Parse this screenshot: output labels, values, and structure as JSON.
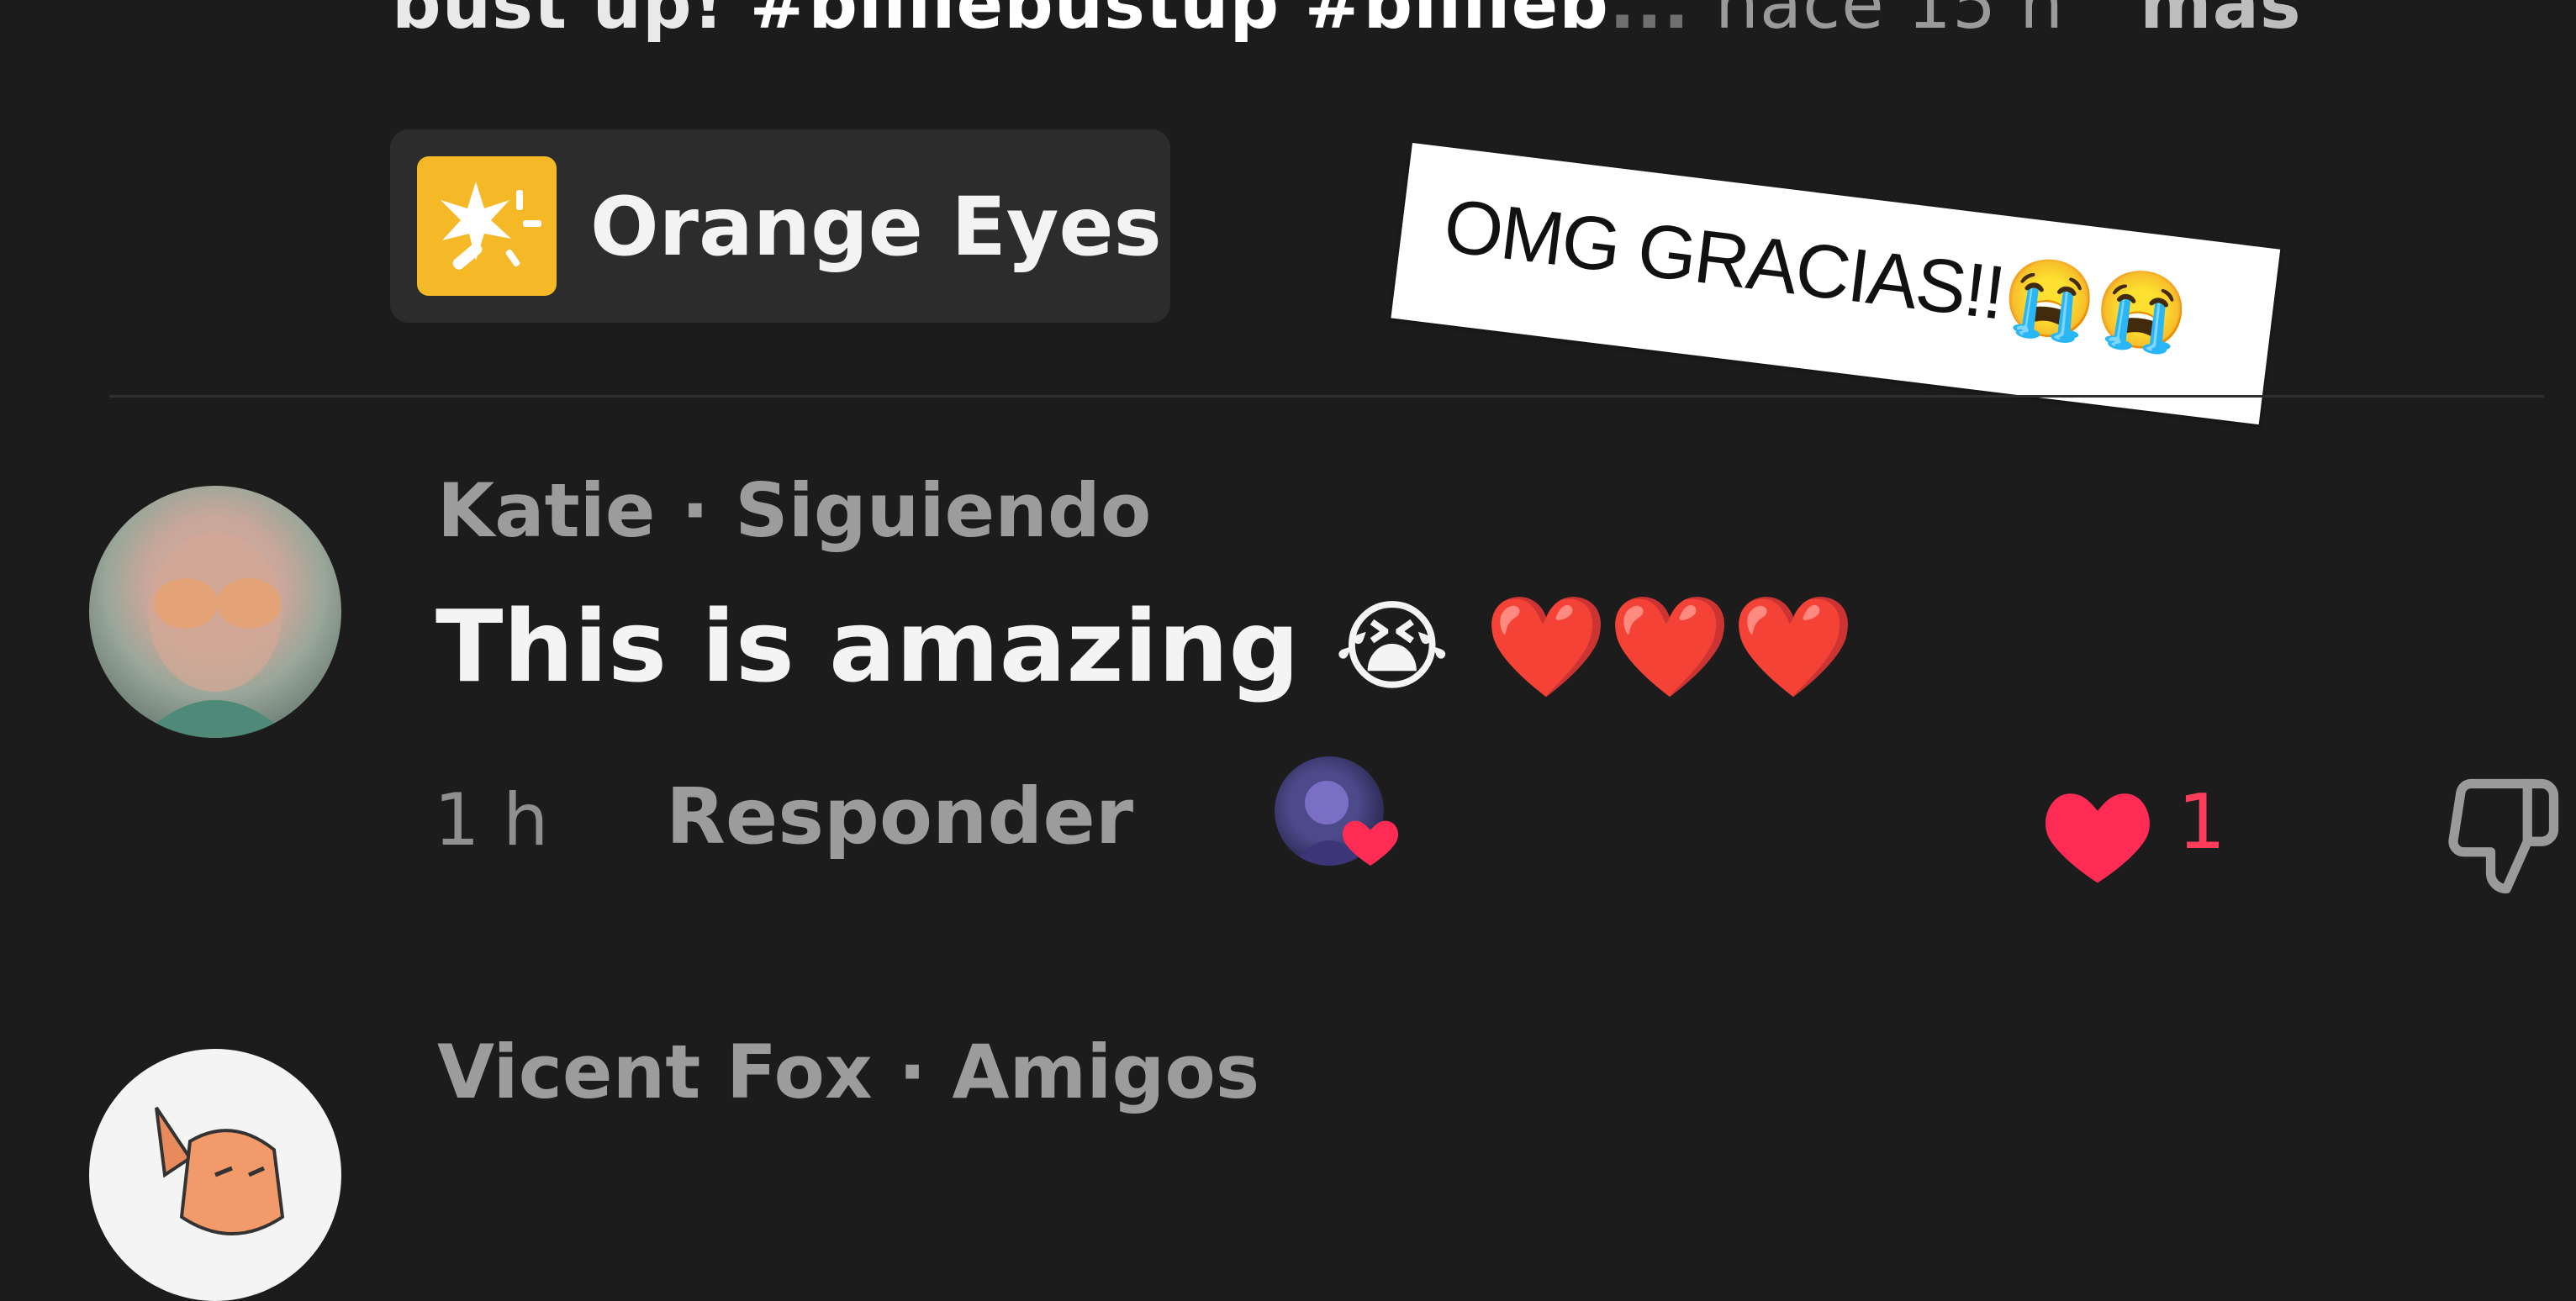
{
  "caption": {
    "text_lead": "bust up! ",
    "tags": "#billiebustup #billieb",
    "ellipsis": "... ",
    "time": "hace 15 h",
    "more": "más"
  },
  "effect": {
    "label": "Orange Eyes",
    "icon": "sparkle-wand-icon",
    "icon_color": "#f5b827"
  },
  "sticker": {
    "text": "OMG GRACIAS!!😭😭"
  },
  "comments": [
    {
      "author": "Katie",
      "separator": " · ",
      "relation": "Siguiendo",
      "text": "This is amazing 😭 ❤️❤️❤️",
      "time": "1 h",
      "reply": "Responder",
      "likes": "1",
      "like_color": "#fe2c55"
    },
    {
      "author": "Vicent Fox",
      "separator": " · ",
      "relation": "Amigos"
    }
  ]
}
